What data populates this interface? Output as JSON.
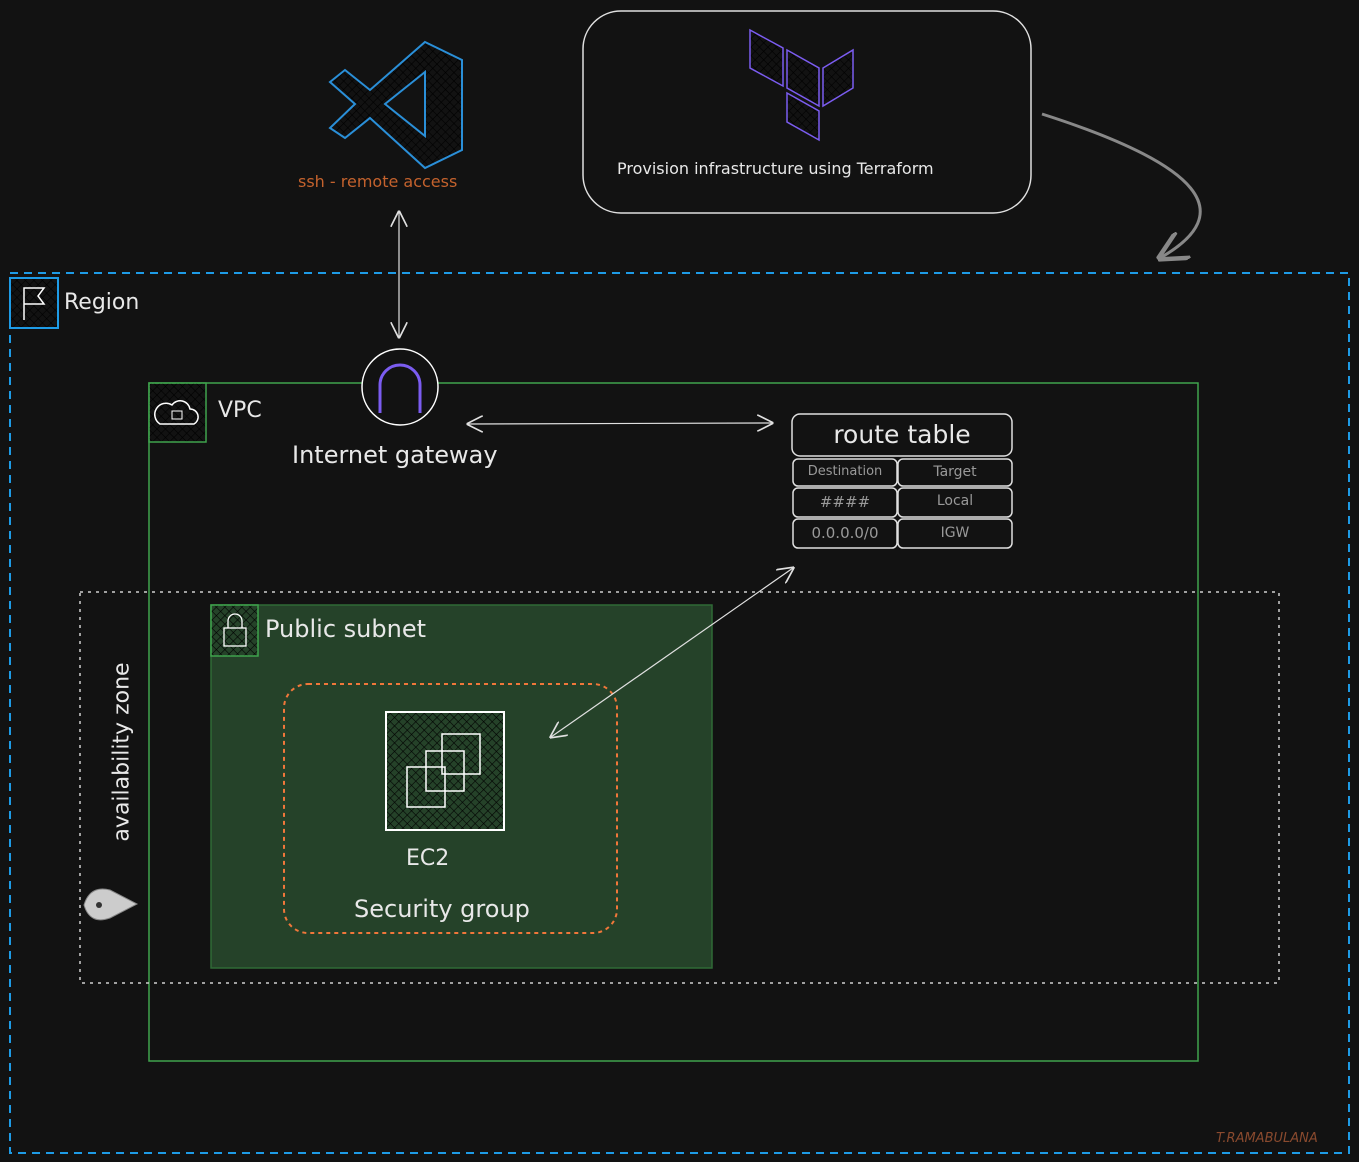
{
  "remote_access": {
    "label": "ssh - remote access"
  },
  "terraform": {
    "label": "Provision infrastructure using Terraform"
  },
  "region": {
    "label": "Region"
  },
  "vpc": {
    "label": "VPC"
  },
  "internet_gateway": {
    "label": "Internet gateway"
  },
  "route_table": {
    "title": "route table",
    "headers": [
      "Destination",
      "Target"
    ],
    "rows": [
      [
        "####",
        "Local"
      ],
      [
        "0.0.0.0/0",
        "IGW"
      ]
    ]
  },
  "availability_zone": {
    "label": "availability zone"
  },
  "public_subnet": {
    "label": "Public subnet"
  },
  "ec2": {
    "label": "EC2"
  },
  "security_group": {
    "label": "Security group"
  },
  "signature": "T.RAMABULANA",
  "colors": {
    "region": "#1e9be6",
    "vpc": "#3fa34d",
    "subnet_fill": "#254229",
    "security_group": "#f0773a",
    "ec2": "#c4600e",
    "terraform": "#7b5cf0",
    "vscode": "#2a8fd8",
    "accent_text": "#c4622d"
  }
}
